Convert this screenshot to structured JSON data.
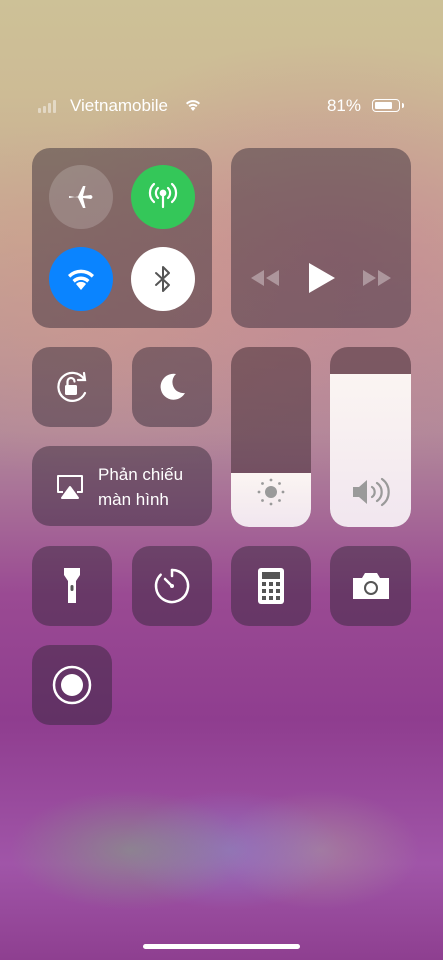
{
  "status_bar": {
    "carrier": "Vietnamobile",
    "battery_percent": "81%",
    "battery_level": 0.81,
    "signal_bars_active": 0
  },
  "connectivity": {
    "airplane_mode": {
      "icon": "airplane-icon",
      "enabled": false
    },
    "cellular_data": {
      "icon": "antenna-icon",
      "enabled": true,
      "color": "#34c759"
    },
    "wifi": {
      "icon": "wifi-icon",
      "enabled": true,
      "color": "#0a84ff"
    },
    "bluetooth": {
      "icon": "bluetooth-icon",
      "enabled": true,
      "color": "#ffffff"
    }
  },
  "media": {
    "buttons": [
      "rewind-icon",
      "play-icon",
      "fast-forward-icon"
    ]
  },
  "orientation_lock": {
    "icon": "rotation-lock-icon"
  },
  "do_not_disturb": {
    "icon": "moon-icon"
  },
  "screen_mirroring": {
    "label_line1": "Phản chiếu",
    "label_line2": "màn hình",
    "icon": "airplay-icon"
  },
  "brightness": {
    "level": 0.3,
    "icon": "sun-icon"
  },
  "volume": {
    "level": 0.85,
    "icon": "speaker-icon"
  },
  "shortcuts": [
    {
      "name": "flashlight",
      "icon": "flashlight-icon"
    },
    {
      "name": "timer",
      "icon": "timer-icon"
    },
    {
      "name": "calculator",
      "icon": "calculator-icon"
    },
    {
      "name": "camera",
      "icon": "camera-icon"
    },
    {
      "name": "screen-recording",
      "icon": "record-icon"
    }
  ]
}
